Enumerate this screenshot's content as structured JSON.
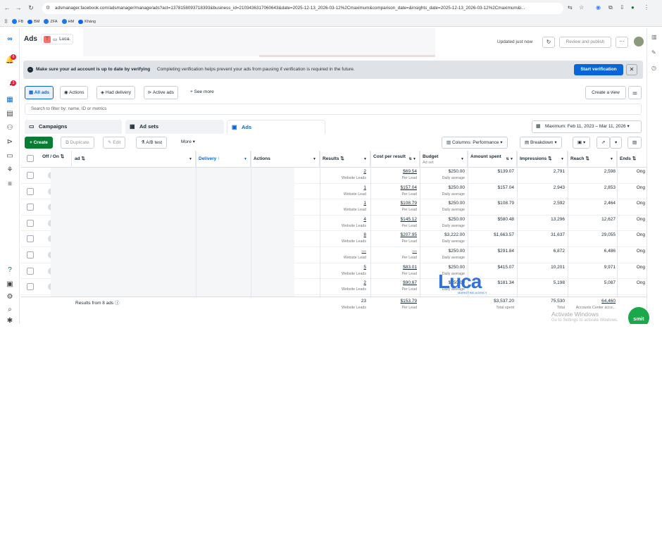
{
  "browser": {
    "url": "adsmanager.facebook.com/adsmanager/manage/ads?act=1378158093718393&business_id=2103436317060643&date=2025-12-13_2026-03-12%2Cmaximum&comparison_date=&insights_date=2025-12-13_2026-03-12%2Cmaximum&i...",
    "bookmarks": [
      "FB",
      "BM",
      "ZFA",
      "HM",
      "Kháng"
    ]
  },
  "nav": {
    "notification_badge": "6",
    "alert_badge": "3"
  },
  "header": {
    "title": "Ads",
    "account_initial": "T",
    "account_name": "Luca.",
    "updated": "Updated just now",
    "review_publish": "Review and publish",
    "more": "···"
  },
  "banner": {
    "title": "Make sure your ad account is up to date by verifying",
    "body": "Completing verification helps prevent your ads from pausing if verification is required in the future.",
    "button": "Start verification"
  },
  "filters": {
    "chips": [
      "All ads",
      "Actions",
      "Had delivery",
      "Active ads",
      "See more"
    ],
    "create_view": "Create a view",
    "search_placeholder": "Search to filter by: name, ID or metrics"
  },
  "tabs": {
    "campaigns": "Campaigns",
    "adsets": "Ad sets",
    "ads": "Ads",
    "date_range": "Maximum: Feb 11, 2023 – Mar 11, 2026"
  },
  "toolbar": {
    "create": "Create",
    "duplicate": "Duplicate",
    "edit": "Edit",
    "abtest": "A/B test",
    "more": "More",
    "columns": "Columns: Performance",
    "breakdown": "Breakdown"
  },
  "table": {
    "headers": {
      "offon": "Off / On",
      "ad": "ad",
      "delivery": "Delivery",
      "actions": "Actions",
      "results": "Results",
      "cpr": "Cost per result",
      "budget": "Budget",
      "budget_sub": "Ad set",
      "amount": "Amount spent",
      "impressions": "Impressions",
      "reach": "Reach",
      "ends": "Ends"
    },
    "rows": [
      {
        "results": "2",
        "results_sub": "Website Leads",
        "cpr": "$69.54",
        "cpr_sub": "Per Lead",
        "budget": "$250.00",
        "budget_sub": "Daily average",
        "amount": "$139.07",
        "impressions": "2,791",
        "reach": "2,598",
        "ends": "Ong"
      },
      {
        "results": "1",
        "results_sub": "Website Lead",
        "cpr": "$157.04",
        "cpr_sub": "Per Lead",
        "budget": "$250.00",
        "budget_sub": "Daily average",
        "amount": "$157.04",
        "impressions": "2,943",
        "reach": "2,853",
        "ends": "Ong"
      },
      {
        "results": "1",
        "results_sub": "Website Lead",
        "cpr": "$108.79",
        "cpr_sub": "Per Lead",
        "budget": "$250.00",
        "budget_sub": "Daily average",
        "amount": "$108.79",
        "impressions": "2,592",
        "reach": "2,464",
        "ends": "Ong"
      },
      {
        "results": "4",
        "results_sub": "Website Leads",
        "cpr": "$145.12",
        "cpr_sub": "Per Lead",
        "budget": "$250.00",
        "budget_sub": "Daily average",
        "amount": "$580.48",
        "impressions": "13,296",
        "reach": "12,627",
        "ends": "Ong"
      },
      {
        "results": "8",
        "results_sub": "Website Leads",
        "cpr": "$207.95",
        "cpr_sub": "Per Lead",
        "budget": "$3,222.00",
        "budget_sub": "Daily average",
        "amount": "$1,663.57",
        "impressions": "31,637",
        "reach": "29,055",
        "ends": "Ong"
      },
      {
        "results": "—",
        "results_sub": "Website Lead",
        "cpr": "—",
        "cpr_sub": "Per Lead",
        "budget": "$250.00",
        "budget_sub": "Daily average",
        "amount": "$291.84",
        "impressions": "6,872",
        "reach": "6,486",
        "ends": "Ong"
      },
      {
        "results": "5",
        "results_sub": "Website Leads",
        "cpr": "$83.01",
        "cpr_sub": "Per Lead",
        "budget": "$250.00",
        "budget_sub": "Daily average",
        "amount": "$415.07",
        "impressions": "10,201",
        "reach": "9,971",
        "ends": "Ong"
      },
      {
        "results": "2",
        "results_sub": "Website Leads",
        "cpr": "$90.67",
        "cpr_sub": "Per Lead",
        "budget": "$250.00",
        "budget_sub": "Daily average",
        "amount": "$181.34",
        "impressions": "5,198",
        "reach": "5,087",
        "ends": "Ong"
      }
    ],
    "footer": {
      "label": "Results from 8 ads",
      "results": "23",
      "results_sub": "Website Leads",
      "cpr": "$153.79",
      "cpr_sub": "Per Lead",
      "amount": "$3,537.20",
      "amount_sub": "Total spent",
      "impressions": "75,530",
      "impressions_sub": "Total",
      "reach": "64,460",
      "reach_sub": "Accounts Center acco..."
    }
  },
  "overlay": {
    "watermark": "Luca",
    "watermark_sub": "MARKETING AGENCY",
    "activate_title": "Activate Windows",
    "activate_sub": "Go to Settings to activate Windows.",
    "chat_label": "smit"
  }
}
